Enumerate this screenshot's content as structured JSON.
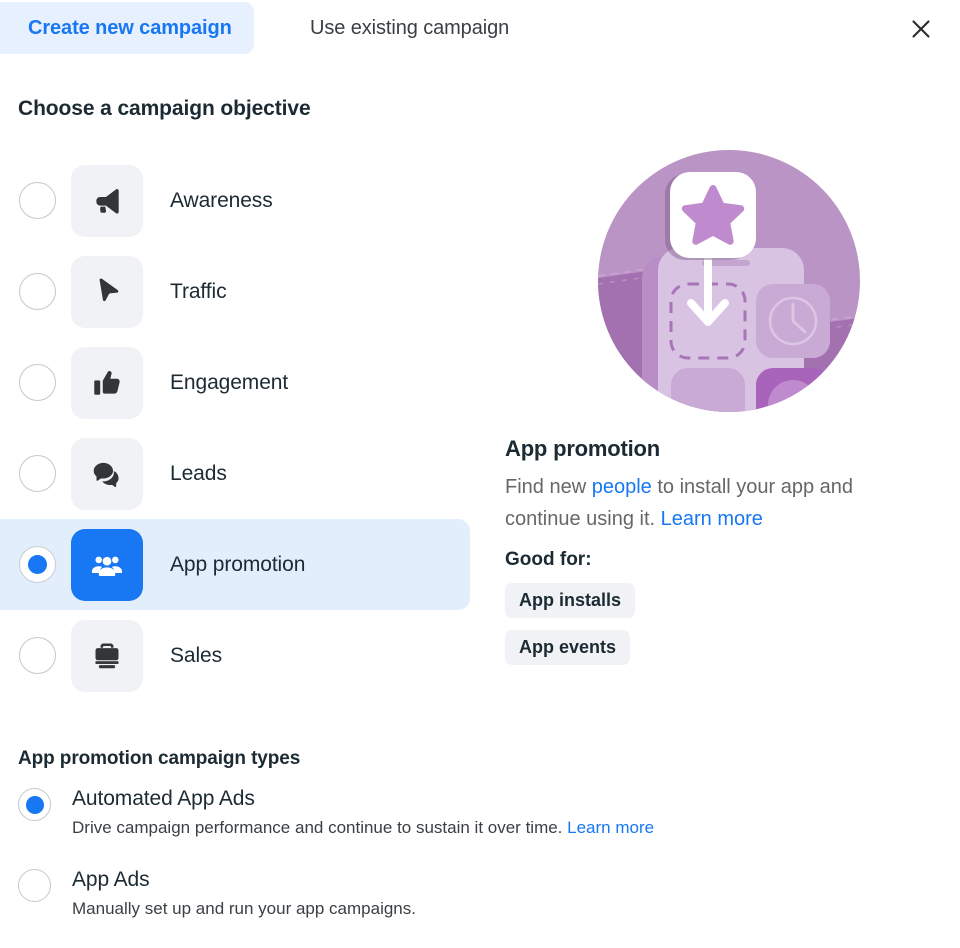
{
  "tabs": {
    "create_label": "Create new campaign",
    "existing_label": "Use existing campaign",
    "close_icon": "close-icon",
    "active_color": "#1877f2",
    "active_bg": "#e7f0fe"
  },
  "objective_section": {
    "title": "Choose a campaign objective",
    "selected": "App promotion",
    "items": [
      {
        "label": "Awareness",
        "icon": "megaphone-icon",
        "selected": false
      },
      {
        "label": "Traffic",
        "icon": "cursor-arrow-icon",
        "selected": false
      },
      {
        "label": "Engagement",
        "icon": "thumbs-up-icon",
        "selected": false
      },
      {
        "label": "Leads",
        "icon": "speech-bubbles-icon",
        "selected": false
      },
      {
        "label": "App promotion",
        "icon": "people-group-icon",
        "selected": true
      },
      {
        "label": "Sales",
        "icon": "briefcase-icon",
        "selected": false
      }
    ]
  },
  "detail": {
    "illustration": "app-promotion-illustration",
    "heading": "App promotion",
    "desc_part1": "Find new ",
    "desc_link1": "people",
    "desc_part2": " to install your app and continue using it. ",
    "desc_link2": "Learn more",
    "good_for_label": "Good for:",
    "chips": [
      "App installs",
      "App events"
    ]
  },
  "campaign_types": {
    "title": "App promotion campaign types",
    "items": [
      {
        "name": "Automated App Ads",
        "desc": "Drive campaign performance and continue to sustain it over time. ",
        "link": "Learn more",
        "selected": true
      },
      {
        "name": "App Ads",
        "desc": "Manually set up and run your app campaigns.",
        "link": "",
        "selected": false
      }
    ]
  },
  "colors": {
    "accent": "#1877f2",
    "selected_row_bg": "#e3eefc",
    "tile_bg": "#f0f2f5",
    "text": "#1c2b33",
    "muted_text": "#65676b",
    "illustration_purple": "#ba94c4"
  }
}
